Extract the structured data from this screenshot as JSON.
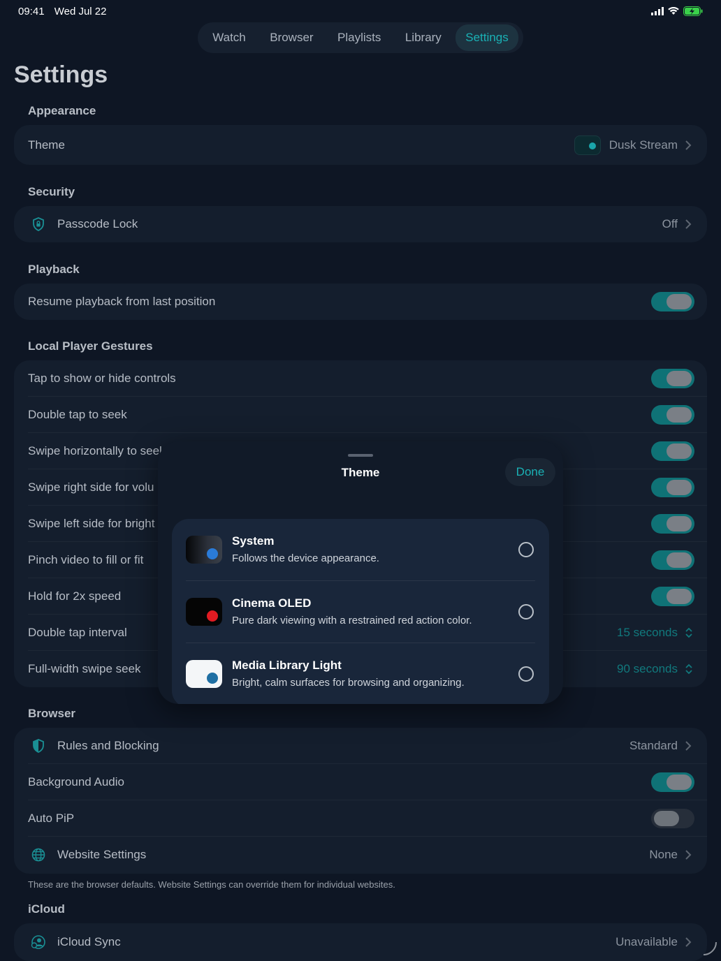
{
  "status_bar": {
    "time": "09:41",
    "date": "Wed Jul 22"
  },
  "tabs": [
    {
      "label": "Watch",
      "active": false
    },
    {
      "label": "Browser",
      "active": false
    },
    {
      "label": "Playlists",
      "active": false
    },
    {
      "label": "Library",
      "active": false
    },
    {
      "label": "Settings",
      "active": true
    }
  ],
  "page_title": "Settings",
  "appearance": {
    "title": "Appearance",
    "theme_label": "Theme",
    "theme_value": "Dusk Stream"
  },
  "security": {
    "title": "Security",
    "passcode_label": "Passcode Lock",
    "passcode_value": "Off"
  },
  "playback": {
    "title": "Playback",
    "resume_label": "Resume playback from last position",
    "resume_on": true
  },
  "gestures": {
    "title": "Local Player Gestures",
    "items": [
      {
        "label": "Tap to show or hide controls",
        "on": true
      },
      {
        "label": "Double tap to seek",
        "on": true
      },
      {
        "label": "Swipe horizontally to seek",
        "on": true
      },
      {
        "label": "Swipe right side for volu",
        "on": true
      },
      {
        "label": "Swipe left side for bright",
        "on": true
      },
      {
        "label": "Pinch video to fill or fit",
        "on": true
      },
      {
        "label": "Hold for 2x speed",
        "on": true
      }
    ],
    "double_tap_interval_label": "Double tap interval",
    "double_tap_interval_value": "15 seconds",
    "full_width_label": "Full-width swipe seek",
    "full_width_value": "90 seconds"
  },
  "browser": {
    "title": "Browser",
    "rules_label": "Rules and Blocking",
    "rules_value": "Standard",
    "bg_audio_label": "Background Audio",
    "bg_audio_on": true,
    "auto_pip_label": "Auto PiP",
    "auto_pip_on": false,
    "website_label": "Website Settings",
    "website_value": "None",
    "footnote": "These are the browser defaults. Website Settings can override them for individual websites."
  },
  "icloud": {
    "title": "iCloud",
    "sync_label": "iCloud Sync",
    "sync_value": "Unavailable"
  },
  "theme_sheet": {
    "title": "Theme",
    "done_label": "Done",
    "options": [
      {
        "name": "System",
        "desc": "Follows the device appearance.",
        "swatch_bg": "#2a2f38",
        "dot": "#2a7bd8"
      },
      {
        "name": "Cinema OLED",
        "desc": "Pure dark viewing with a restrained red action color.",
        "swatch_bg": "#050505",
        "dot": "#e11b22"
      },
      {
        "name": "Media Library Light",
        "desc": "Bright, calm surfaces for browsing and organizing.",
        "swatch_bg": "#f4f6f8",
        "dot": "#1f6fa3"
      }
    ]
  },
  "colors": {
    "accent": "#1ab1b5",
    "toggle_on": "#0f7276",
    "background": "#0e1624"
  }
}
